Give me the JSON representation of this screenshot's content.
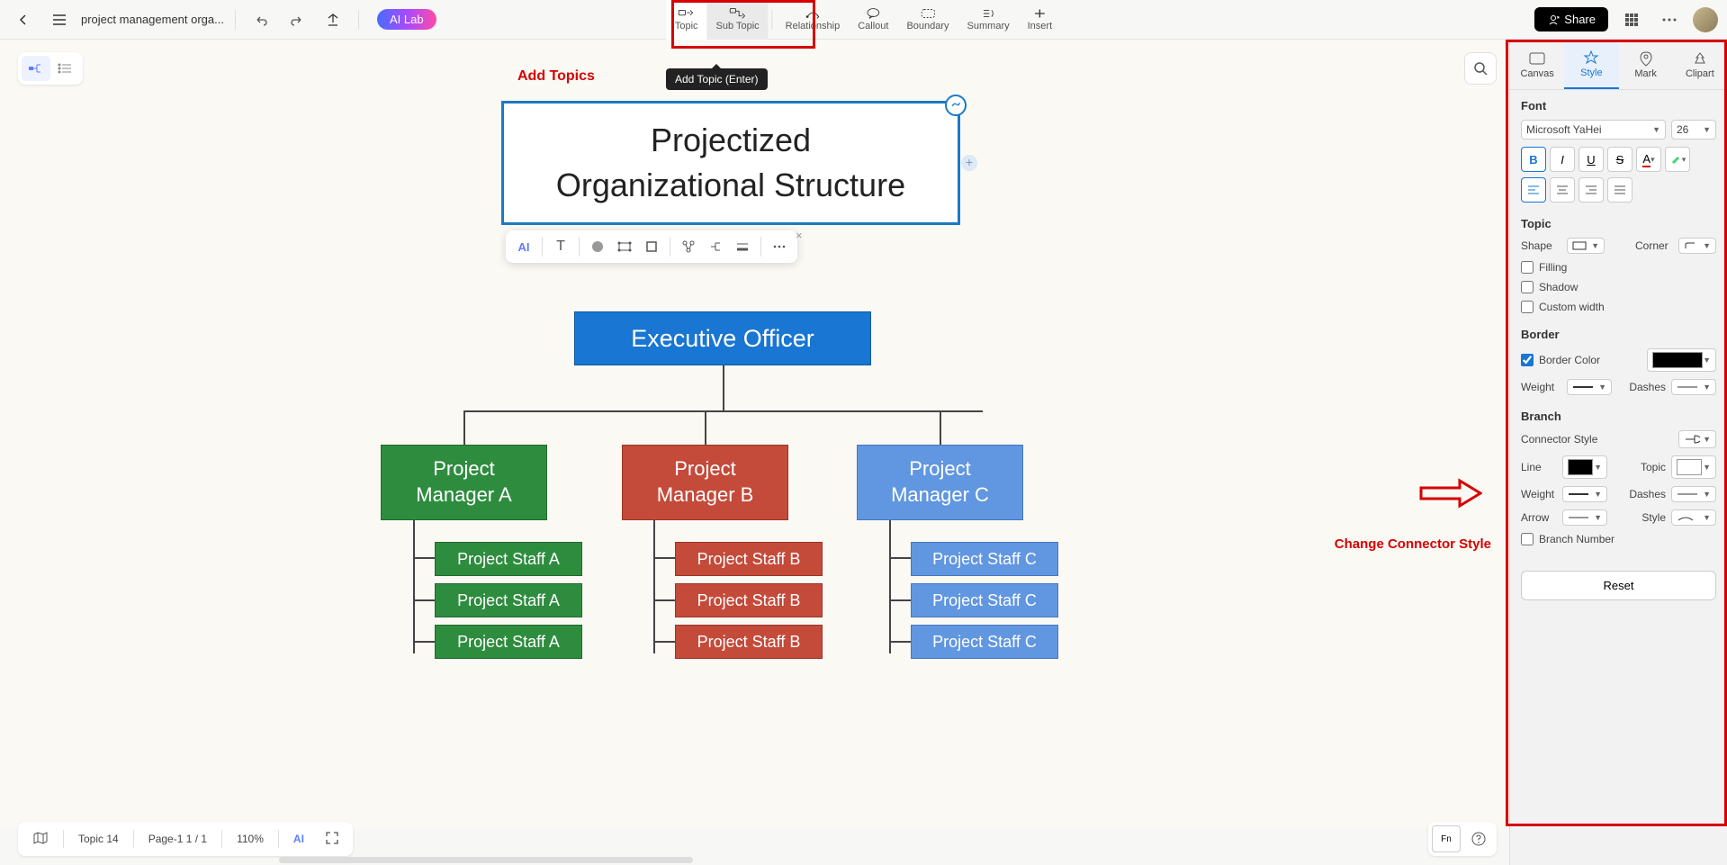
{
  "header": {
    "file_name": "project management orga...",
    "ai_lab": "AI Lab",
    "share": "Share"
  },
  "toolbar": {
    "topic": "Topic",
    "subtopic": "Sub Topic",
    "relationship": "Relationship",
    "callout": "Callout",
    "boundary": "Boundary",
    "summary": "Summary",
    "insert": "Insert",
    "tooltip": "Add Topic (Enter)"
  },
  "annotations": {
    "add_topics": "Add Topics",
    "change_connector": "Change Connector Style"
  },
  "mindmap": {
    "main_line1": "Projectized",
    "main_line2": "Organizational Structure",
    "exec": "Executive Officer",
    "pma_l1": "Project",
    "pma_l2": "Manager A",
    "pmb_l1": "Project",
    "pmb_l2": "Manager B",
    "pmc_l1": "Project",
    "pmc_l2": "Manager C",
    "staff_a1": "Project Staff A",
    "staff_a2": "Project Staff A",
    "staff_a3": "Project Staff A",
    "staff_b1": "Project Staff B",
    "staff_b2": "Project Staff B",
    "staff_b3": "Project Staff B",
    "staff_c1": "Project Staff C",
    "staff_c2": "Project Staff C",
    "staff_c3": "Project Staff C"
  },
  "floating": {
    "ai": "AI",
    "t": "T"
  },
  "panel": {
    "tabs": {
      "canvas": "Canvas",
      "style": "Style",
      "mark": "Mark",
      "clipart": "Clipart"
    },
    "font": {
      "title": "Font",
      "family": "Microsoft YaHei",
      "size": "26"
    },
    "topic": {
      "title": "Topic",
      "shape": "Shape",
      "corner": "Corner",
      "filling": "Filling",
      "shadow": "Shadow",
      "custom_width": "Custom width"
    },
    "border": {
      "title": "Border",
      "border_color": "Border Color",
      "weight": "Weight",
      "dashes": "Dashes"
    },
    "branch": {
      "title": "Branch",
      "connector_style": "Connector Style",
      "line": "Line",
      "topic": "Topic",
      "weight": "Weight",
      "dashes": "Dashes",
      "arrow": "Arrow",
      "style": "Style",
      "branch_number": "Branch Number"
    },
    "reset": "Reset"
  },
  "bottom": {
    "topic_count": "Topic 14",
    "page": "Page-1  1 / 1",
    "zoom": "110%",
    "ai": "AI"
  }
}
